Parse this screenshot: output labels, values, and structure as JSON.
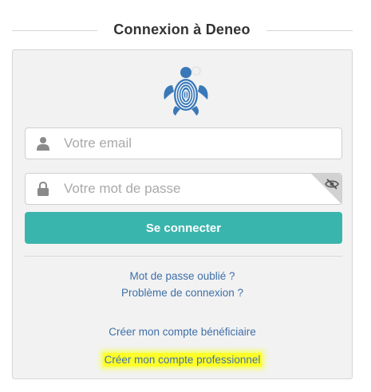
{
  "header": {
    "title": "Connexion à Deneo"
  },
  "logo": {
    "icon": "turtle-fingerprint-logo",
    "color": "#3a78b8"
  },
  "login_form": {
    "email": {
      "value": "",
      "placeholder": "Votre email",
      "icon": "user-icon"
    },
    "password": {
      "value": "",
      "placeholder": "Votre mot de passe",
      "icon": "lock-icon",
      "toggle_icon": "eye-slash-icon"
    },
    "submit_label": "Se connecter",
    "accent_color": "#3ab5ad"
  },
  "links": {
    "forgot_password": "Mot de passe oublié ?",
    "connection_problem": "Problème de connexion ?",
    "create_beneficiary": "Créer mon compte bénéficiaire",
    "create_professional": "Créer mon compte professionnel",
    "link_color": "#3f6fa8",
    "highlight_color": "#ffff28"
  }
}
